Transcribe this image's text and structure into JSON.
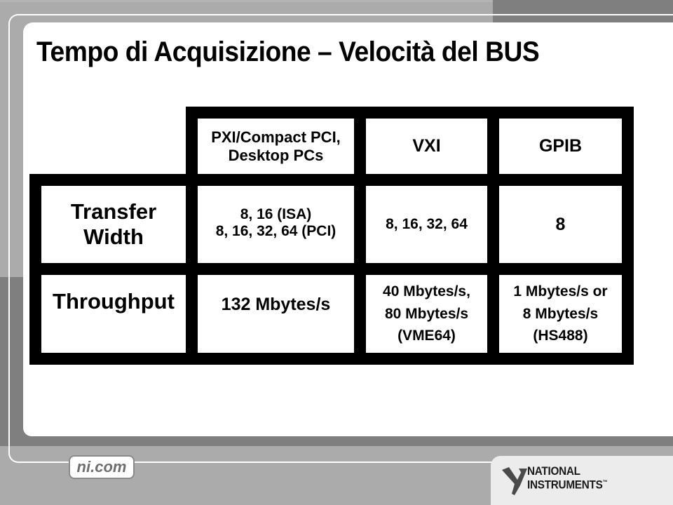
{
  "slide": {
    "title": "Tempo di Acquisizione – Velocità del BUS"
  },
  "table": {
    "columns": [
      {
        "label_lines": [
          "PXI/Compact PCI,",
          "Desktop PCs"
        ]
      },
      {
        "label_lines": [
          "VXI"
        ]
      },
      {
        "label_lines": [
          "GPIB"
        ]
      }
    ],
    "rows": [
      {
        "header_lines": [
          "Transfer",
          "Width"
        ],
        "cells": [
          [
            "8, 16 (ISA)",
            "8, 16, 32, 64 (PCI)"
          ],
          [
            "8, 16, 32, 64"
          ],
          [
            "8"
          ]
        ]
      },
      {
        "header_lines": [
          "Throughput"
        ],
        "cells": [
          [
            "132 Mbytes/s"
          ],
          [
            "40 Mbytes/s,",
            "80 Mbytes/s",
            "(VME64)"
          ],
          [
            "1 Mbytes/s or",
            "8 Mbytes/s",
            "(HS488)"
          ]
        ]
      }
    ]
  },
  "footer": {
    "website_badge": "ni.com",
    "logo_line1": "NATIONAL",
    "logo_line2": "INSTRUMENTS",
    "logo_tm": "™"
  },
  "colors": {
    "background": "#ababab",
    "dark_band": "#7f7f7f",
    "panel": "#ffffff",
    "table_border": "#000000",
    "logo_box": "#ececec"
  }
}
